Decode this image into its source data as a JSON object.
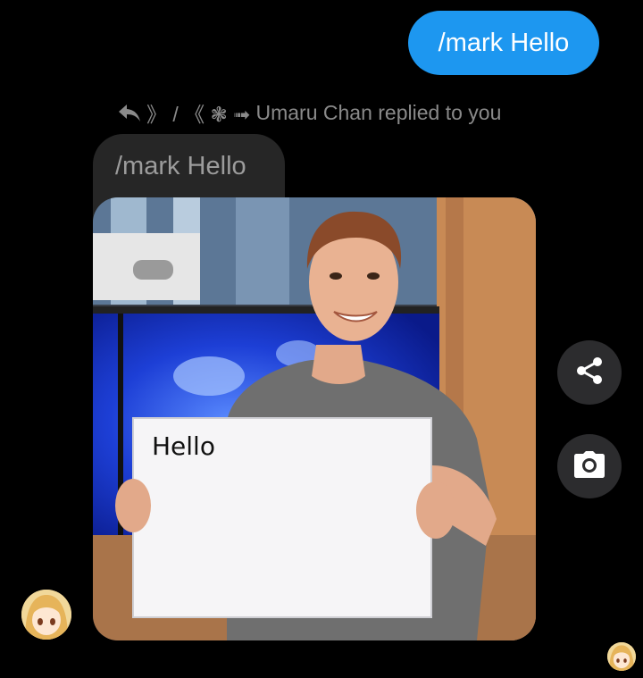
{
  "sent_message": {
    "text": "/mark Hello"
  },
  "reply_header": {
    "decor": "》 / 《 ❃ ➟",
    "text": "Umaru Chan replied to you"
  },
  "quoted_message": {
    "text": "/mark Hello"
  },
  "image_message": {
    "sign_text": "Hello"
  },
  "actions": {
    "share_icon": "share-icon",
    "camera_icon": "camera-icon"
  },
  "colors": {
    "background": "#000000",
    "sent_bubble": "#1d97f0",
    "quoted_bubble": "#262626",
    "action_button": "#2c2c2e"
  }
}
